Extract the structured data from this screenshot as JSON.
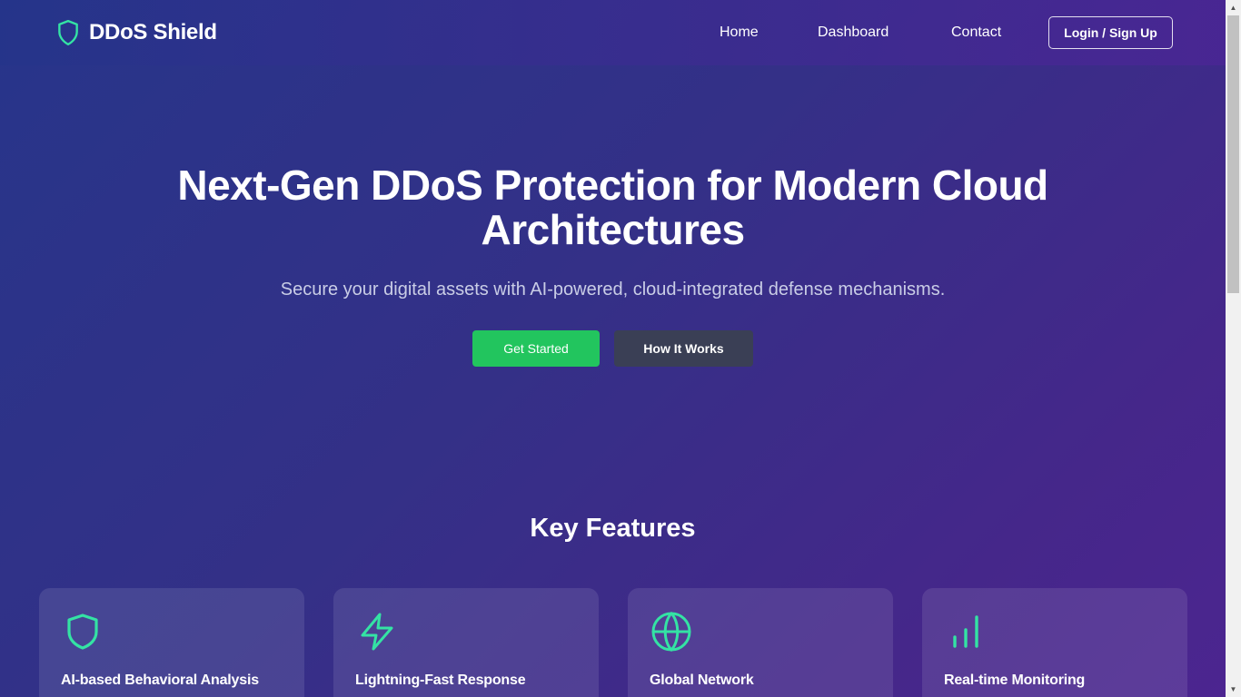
{
  "nav": {
    "brand": "DDoS Shield",
    "links": [
      "Home",
      "Dashboard",
      "Contact"
    ],
    "login_label": "Login / Sign Up"
  },
  "hero": {
    "title_line1": "Next-Gen DDoS Protection for Modern Cloud",
    "title_line2": "Architectures",
    "subtitle": "Secure your digital assets with AI-powered, cloud-integrated defense mechanisms.",
    "primary_button": "Get Started",
    "secondary_button": "How It Works"
  },
  "features": {
    "heading": "Key Features",
    "items": [
      {
        "title": "AI-based Behavioral Analysis",
        "icon": "shield-icon"
      },
      {
        "title": "Lightning-Fast Response",
        "icon": "lightning-icon"
      },
      {
        "title": "Global Network",
        "icon": "globe-icon"
      },
      {
        "title": "Real-time Monitoring",
        "icon": "bar-chart-icon"
      }
    ]
  },
  "colors": {
    "accent": "#34e3a4",
    "primary_button": "#22c55e",
    "secondary_button": "#3a3f55",
    "background_start": "#27358a",
    "background_end": "#4c2590"
  }
}
